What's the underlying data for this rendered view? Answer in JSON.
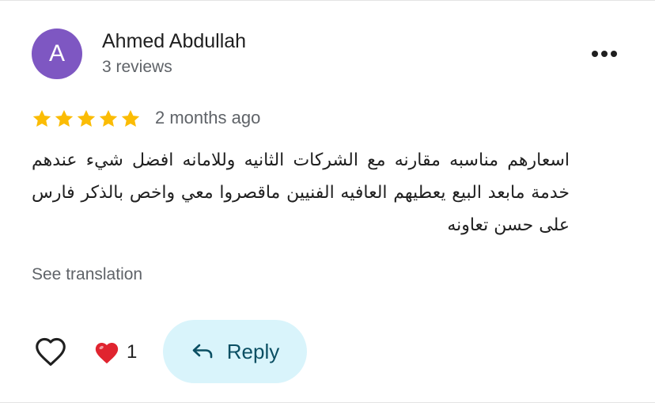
{
  "review": {
    "author_initial": "A",
    "author_name": "Ahmed Abdullah",
    "author_reviews": "3 reviews",
    "rating": 5,
    "rating_max": 5,
    "date": "2 months ago",
    "text": "اسعارهم مناسبه مقارنه مع الشركات الثانيه وللامانه افضل شيء عندهم خدمة مابعد البيع يعطيهم العافيه الفنيين ماقصروا معي واخص بالذكر فارس على حسن تعاونه",
    "see_translation": "See translation",
    "reaction_count": "1",
    "reply_label": "Reply"
  },
  "colors": {
    "avatar": "#7e57c2",
    "star": "#fbbc04",
    "reply_bg": "#d9f4fb",
    "reply_text": "#0b4f63",
    "heart_reaction": "#e0242f",
    "muted_text": "#5f6368"
  },
  "icons": {
    "more": "more-horiz-icon",
    "like": "heart-outline-icon",
    "reaction": "red-heart-icon",
    "reply": "reply-arrow-icon"
  }
}
